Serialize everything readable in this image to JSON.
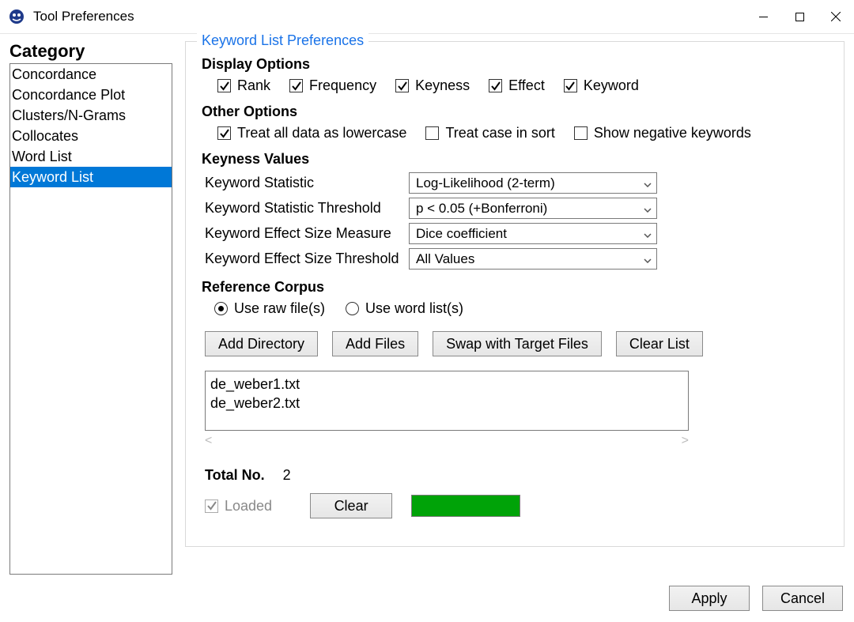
{
  "window": {
    "title": "Tool Preferences"
  },
  "sidebar": {
    "header": "Category",
    "items": [
      "Concordance",
      "Concordance Plot",
      "Clusters/N-Grams",
      "Collocates",
      "Word List",
      "Keyword List"
    ],
    "selected_index": 5
  },
  "panel": {
    "legend": "Keyword List Preferences",
    "display_options": {
      "header": "Display Options",
      "items": [
        {
          "label": "Rank",
          "checked": true
        },
        {
          "label": "Frequency",
          "checked": true
        },
        {
          "label": "Keyness",
          "checked": true
        },
        {
          "label": "Effect",
          "checked": true
        },
        {
          "label": "Keyword",
          "checked": true
        }
      ]
    },
    "other_options": {
      "header": "Other Options",
      "items": [
        {
          "label": "Treat all data as lowercase",
          "checked": true
        },
        {
          "label": "Treat case in sort",
          "checked": false
        },
        {
          "label": "Show negative keywords",
          "checked": false
        }
      ]
    },
    "keyness": {
      "header": "Keyness Values",
      "rows": [
        {
          "label": "Keyword Statistic",
          "value": "Log-Likelihood (2-term)"
        },
        {
          "label": "Keyword Statistic Threshold",
          "value": "p < 0.05 (+Bonferroni)"
        },
        {
          "label": "Keyword Effect Size Measure",
          "value": "Dice coefficient"
        },
        {
          "label": "Keyword Effect Size Threshold",
          "value": "All Values"
        }
      ]
    },
    "reference_corpus": {
      "header": "Reference Corpus",
      "radios": [
        {
          "label": "Use raw file(s)",
          "selected": true
        },
        {
          "label": "Use word list(s)",
          "selected": false
        }
      ],
      "buttons": {
        "add_directory": "Add Directory",
        "add_files": "Add Files",
        "swap": "Swap with Target Files",
        "clear_list": "Clear List"
      },
      "files": [
        "de_weber1.txt",
        "de_weber2.txt"
      ],
      "total_label": "Total No.",
      "total_value": "2",
      "loaded_label": "Loaded",
      "clear_btn": "Clear"
    }
  },
  "footer": {
    "apply": "Apply",
    "cancel": "Cancel"
  }
}
